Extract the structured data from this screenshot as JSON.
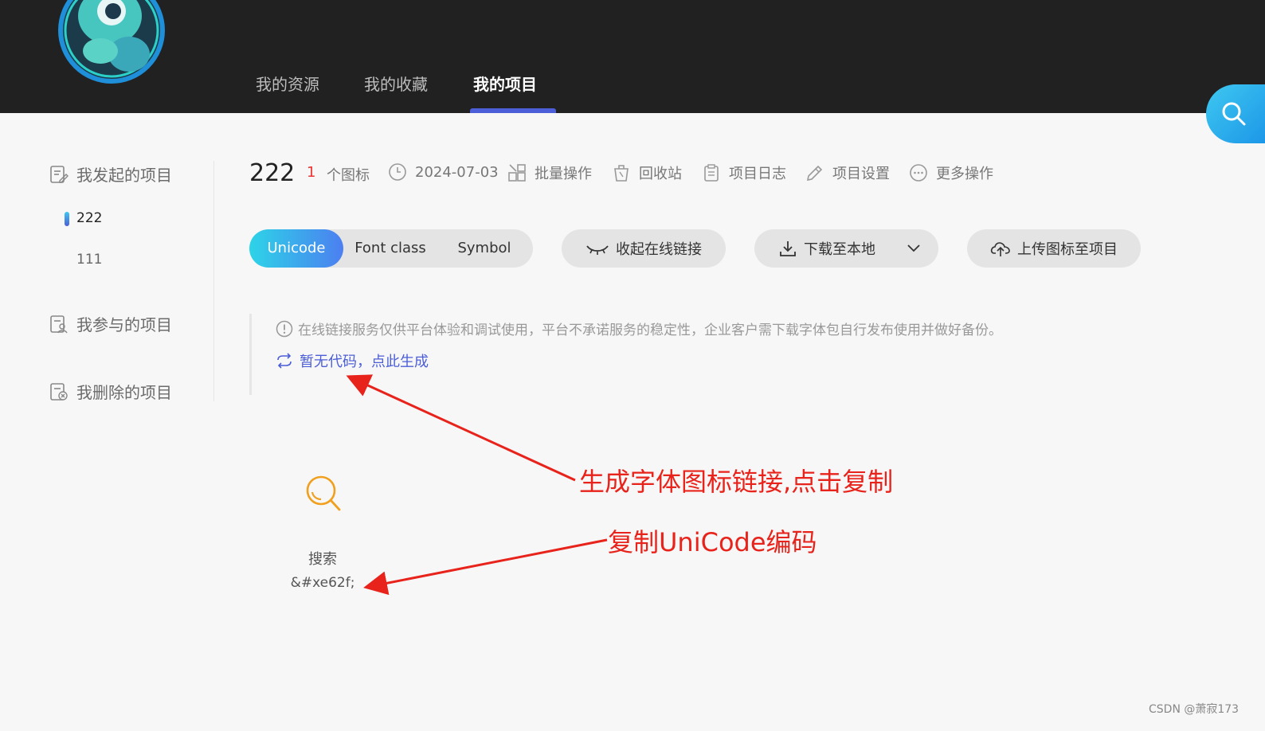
{
  "header": {
    "nav": [
      {
        "label": "我的资源",
        "active": false
      },
      {
        "label": "我的收藏",
        "active": false
      },
      {
        "label": "我的项目",
        "active": true
      }
    ],
    "accent_color": "#4c5fd8"
  },
  "sidebar": {
    "groups": [
      {
        "label": "我发起的项目",
        "icon": "project-edit-icon"
      },
      {
        "label": "我参与的项目",
        "icon": "project-member-icon"
      },
      {
        "label": "我删除的项目",
        "icon": "project-delete-icon"
      }
    ],
    "projects": [
      {
        "label": "222",
        "active": true
      },
      {
        "label": "111",
        "active": false
      }
    ]
  },
  "project": {
    "name": "222",
    "icon_count": "1",
    "icon_count_label": "个图标",
    "date": "2024-07-03",
    "actions": {
      "batch": "批量操作",
      "recycle": "回收站",
      "log": "项目日志",
      "settings": "项目设置",
      "more": "更多操作"
    }
  },
  "code_types": {
    "options": [
      "Unicode",
      "Font class",
      "Symbol"
    ],
    "selected": "Unicode"
  },
  "buttons": {
    "collapse_link": "收起在线链接",
    "download": "下载至本地",
    "upload": "上传图标至项目"
  },
  "notice": {
    "text": "在线链接服务仅供平台体验和调试使用，平台不承诺服务的稳定性，企业客户需下载字体包自行发布使用并做好备份。",
    "generate_link": "暂无代码，点此生成"
  },
  "icons": [
    {
      "name": "搜索",
      "code": "&#xe62f;",
      "glyph": "search-icon",
      "color": "#f0a01e"
    }
  ],
  "annotations": {
    "note_1": "生成字体图标链接,点击复制",
    "note_2": "复制UniCode编码",
    "arrow_color": "#e8231b"
  },
  "watermark": "CSDN @萧寂173"
}
